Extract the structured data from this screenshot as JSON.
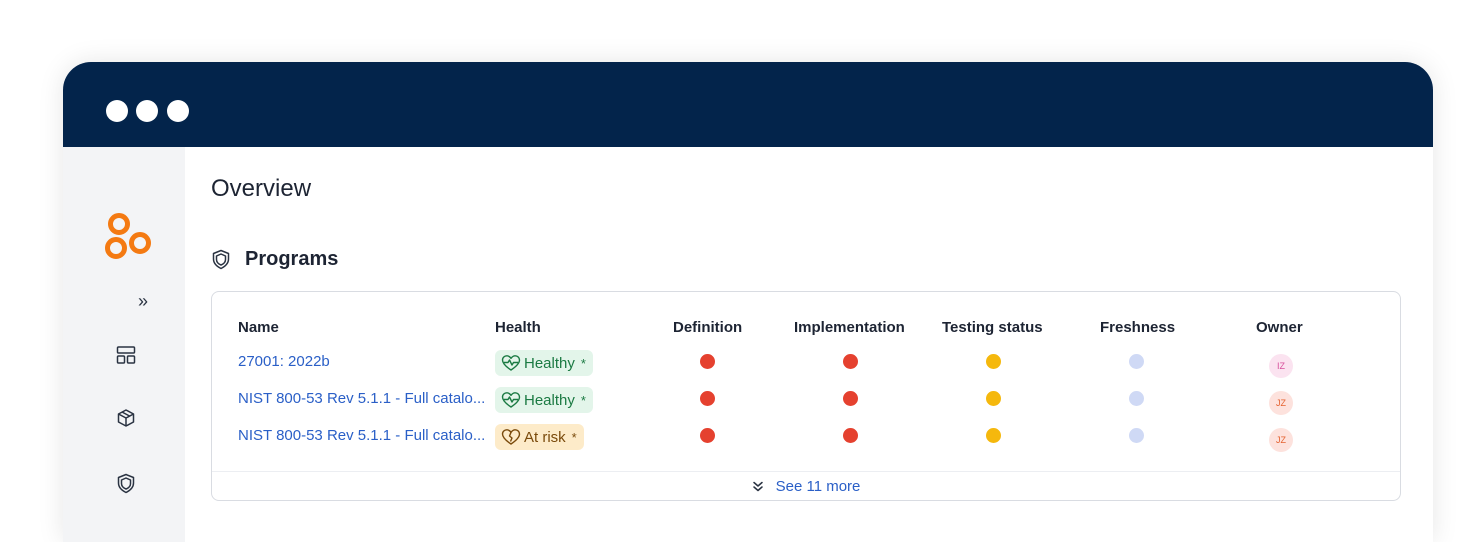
{
  "colors": {
    "titlebar": "#03244b",
    "brand_orange": "#f47a12",
    "link_blue": "#2a5fc7",
    "status_red": "#e5412f",
    "status_yellow": "#f5b80d",
    "status_blue": "#cfd9f5",
    "healthy_bg": "#e3f5ea",
    "atrisk_bg": "#fdebc9"
  },
  "sidebar": {
    "logo_icon": "brand-rings-logo",
    "expand_label": "»",
    "nav_icons": [
      "dashboard-icon",
      "cube-icon",
      "shield-icon"
    ]
  },
  "main": {
    "page_title": "Overview",
    "section": {
      "icon": "shield-icon",
      "title": "Programs"
    },
    "table": {
      "columns": [
        "Name",
        "Health",
        "Definition",
        "Implementation",
        "Testing status",
        "Freshness",
        "Owner"
      ],
      "rows": [
        {
          "name": "27001: 2022b",
          "health": "Healthy",
          "health_marker": "*",
          "definition": "red",
          "implementation": "red",
          "testing_status": "yellow",
          "freshness": "blue",
          "owner_initials": "IZ"
        },
        {
          "name": "NIST 800-53 Rev 5.1.1 - Full catalo...",
          "health": "Healthy",
          "health_marker": "*",
          "definition": "red",
          "implementation": "red",
          "testing_status": "yellow",
          "freshness": "blue",
          "owner_initials": "JZ"
        },
        {
          "name": "NIST 800-53 Rev 5.1.1 - Full catalo...",
          "health": "At risk",
          "health_marker": "*",
          "definition": "red",
          "implementation": "red",
          "testing_status": "yellow",
          "freshness": "blue",
          "owner_initials": "JZ"
        }
      ],
      "see_more_label": "See 11 more"
    }
  }
}
